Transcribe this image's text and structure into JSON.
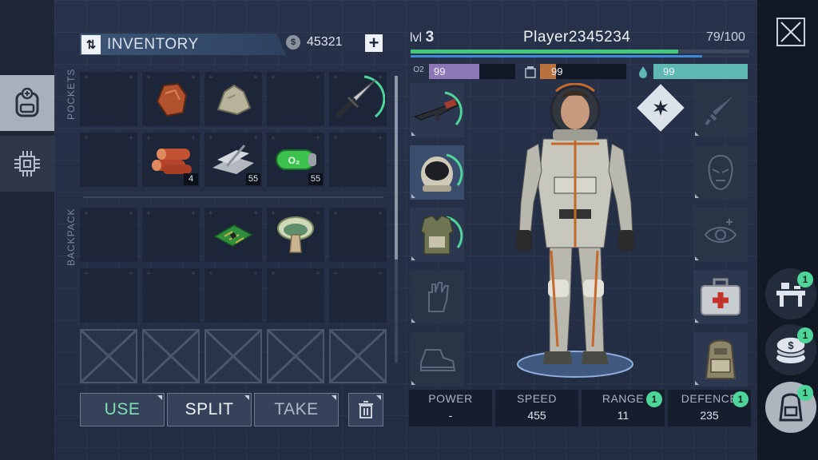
{
  "inventory": {
    "title": "INVENTORY",
    "coins": "45321",
    "coin_symbol": "$",
    "add_symbol": "+",
    "toggle_symbol": "⇅",
    "pockets_label": "POCKETS",
    "backpack_label": "BACKPACK",
    "pockets": [
      {
        "item": "",
        "count": ""
      },
      {
        "item": "ore-icon",
        "count": ""
      },
      {
        "item": "stone-icon",
        "count": ""
      },
      {
        "item": "",
        "count": ""
      },
      {
        "item": "knife-icon",
        "count": ""
      },
      {
        "item": "",
        "count": ""
      },
      {
        "item": "wood-logs-icon",
        "count": "4"
      },
      {
        "item": "scrap-metal-icon",
        "count": "55"
      },
      {
        "item": "oxygen-canister-icon",
        "count": "55"
      },
      {
        "item": "",
        "count": ""
      }
    ],
    "backpack": [
      {
        "item": "",
        "count": ""
      },
      {
        "item": "",
        "count": ""
      },
      {
        "item": "circuit-board-icon",
        "count": ""
      },
      {
        "item": "mushroom-icon",
        "count": ""
      },
      {
        "item": "",
        "count": ""
      },
      {
        "item": "",
        "count": ""
      },
      {
        "item": "",
        "count": ""
      },
      {
        "item": "",
        "count": ""
      },
      {
        "item": "",
        "count": ""
      },
      {
        "item": "",
        "count": ""
      }
    ],
    "locked_slots": 5,
    "actions": {
      "use": "USE",
      "split": "SPLIT",
      "take": "TAKE"
    }
  },
  "character": {
    "level_label": "lvl",
    "level": "3",
    "name": "Player2345234",
    "xp": "79/100",
    "xp_fraction": 0.79,
    "xp2_fraction": 0.86,
    "oxygen": "99",
    "food": "99",
    "water": "99",
    "oxygen_label": "O2",
    "stats": [
      {
        "label": "POWER",
        "value": "-",
        "badge": ""
      },
      {
        "label": "SPEED",
        "value": "455",
        "badge": ""
      },
      {
        "label": "RANGE",
        "value": "11",
        "badge": "1"
      },
      {
        "label": "DEFENCE",
        "value": "235",
        "badge": "1"
      }
    ]
  },
  "side_buttons": [
    {
      "name": "crafting-button",
      "badge": "1"
    },
    {
      "name": "trade-button",
      "badge": "1"
    },
    {
      "name": "backpack-button",
      "badge": "1"
    }
  ],
  "colors": {
    "accent": "#4fd49a",
    "xp": "#45c77b",
    "oxygen": "#8e77b6",
    "food": "#b9713e",
    "water": "#5fb8b2"
  }
}
